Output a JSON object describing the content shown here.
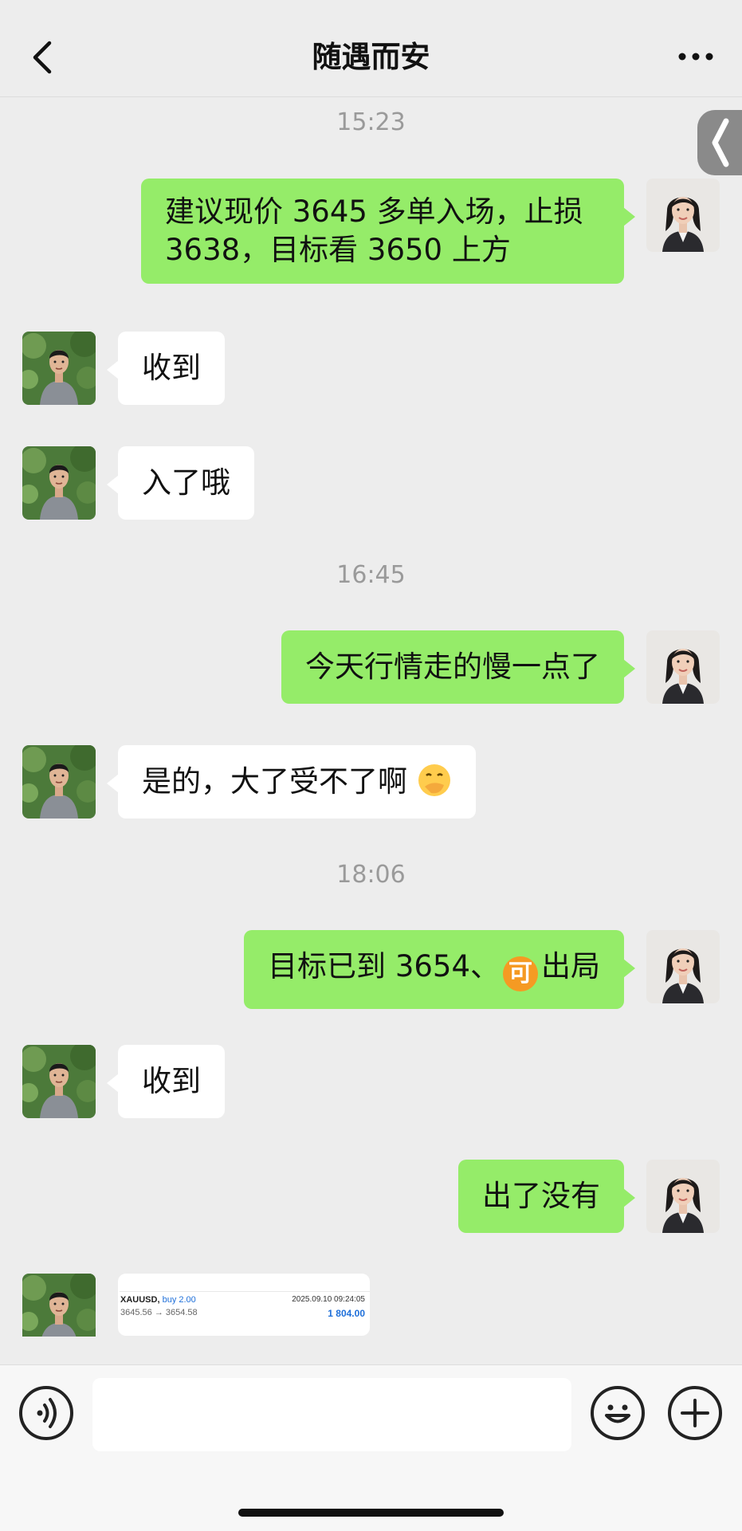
{
  "header": {
    "title": "随遇而安"
  },
  "messages": [
    {
      "type": "time",
      "text": "15:23"
    },
    {
      "type": "me",
      "text": "建议现价 3645 多单入场，止损 3638，目标看 3650 上方"
    },
    {
      "type": "other",
      "text": "收到"
    },
    {
      "type": "other",
      "text": "入了哦"
    },
    {
      "type": "time",
      "text": "16:45"
    },
    {
      "type": "me",
      "text": "今天行情走的慢一点了"
    },
    {
      "type": "other",
      "text": "是的，大了受不了啊",
      "emoji": "hand-over-mouth-face"
    },
    {
      "type": "time",
      "text": "18:06"
    },
    {
      "type": "me",
      "text_before": "目标已到 3654、",
      "badge": "可",
      "text_after": "出局"
    },
    {
      "type": "other",
      "text": "收到"
    },
    {
      "type": "me",
      "text": "出了没有"
    }
  ],
  "trade_card": {
    "symbol": "XAUUSD,",
    "side": "buy 2.00",
    "timestamp": "2025.09.10 09:24:05",
    "prices": "3645.56 → 3654.58",
    "profit": "1 804.00"
  },
  "input_bar": {
    "placeholder": ""
  },
  "icons": {
    "back": "chevron-left-icon",
    "more": "more-dots-icon",
    "side_tab": "chevron-left-icon",
    "voice": "voice-icon",
    "emoji": "smiley-icon",
    "plus": "plus-icon"
  },
  "colors": {
    "background": "#ededed",
    "my_bubble": "#95ec69",
    "other_bubble": "#ffffff",
    "badge": "#f59a23"
  }
}
